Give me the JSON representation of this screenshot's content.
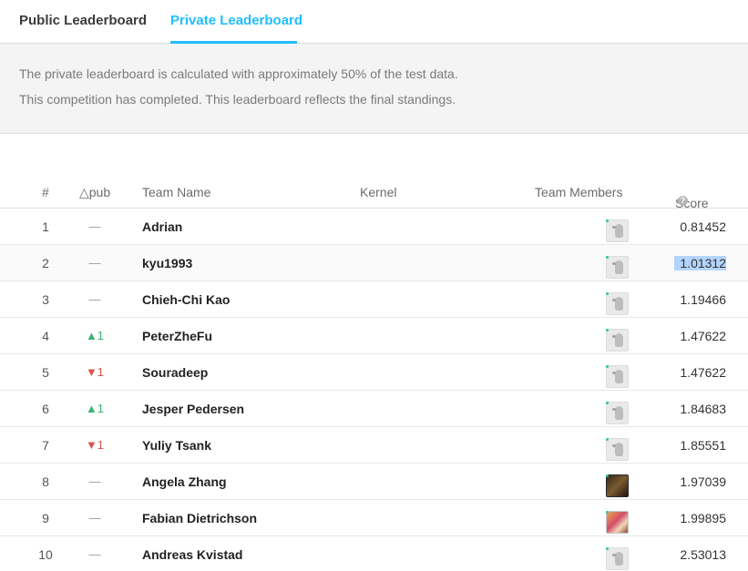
{
  "tabs": {
    "public": "Public Leaderboard",
    "private": "Private Leaderboard",
    "active": "private"
  },
  "info": {
    "line1": "The private leaderboard is calculated with approximately 50% of the test data.",
    "line2": "This competition has completed. This leaderboard reflects the final standings."
  },
  "columns": {
    "rank": "#",
    "pub": "△pub",
    "team": "Team Name",
    "kernel": "Kernel",
    "members": "Team Members",
    "score": "Score"
  },
  "icons": {
    "help": "question-circle-icon",
    "default_avatar": "bird-avatar-icon",
    "up": "triangle-up-icon",
    "down": "triangle-down-icon"
  },
  "colors": {
    "accent": "#20beff",
    "up": "#3cb371",
    "down": "#d9534f",
    "online": "#2ec4a8",
    "selection": "#b3d4fc"
  },
  "rows": [
    {
      "rank": "1",
      "pub": "—",
      "team": "Adrian",
      "kernel": "",
      "score": "0.81452",
      "avatar": "default"
    },
    {
      "rank": "2",
      "pub": "—",
      "team": "kyu1993",
      "kernel": "",
      "score": "1.01312",
      "avatar": "default"
    },
    {
      "rank": "3",
      "pub": "—",
      "team": "Chieh-Chi Kao",
      "kernel": "",
      "score": "1.19466",
      "avatar": "default"
    },
    {
      "rank": "4",
      "pub": "▲1",
      "team": "PeterZheFu",
      "kernel": "",
      "score": "1.47622",
      "avatar": "default"
    },
    {
      "rank": "5",
      "pub": "▼1",
      "team": "Souradeep",
      "kernel": "",
      "score": "1.47622",
      "avatar": "default"
    },
    {
      "rank": "6",
      "pub": "▲1",
      "team": "Jesper Pedersen",
      "kernel": "",
      "score": "1.84683",
      "avatar": "default"
    },
    {
      "rank": "7",
      "pub": "▼1",
      "team": "Yuliy Tsank",
      "kernel": "",
      "score": "1.85551",
      "avatar": "default"
    },
    {
      "rank": "8",
      "pub": "—",
      "team": "Angela Zhang",
      "kernel": "",
      "score": "1.97039",
      "avatar": "photo"
    },
    {
      "rank": "9",
      "pub": "—",
      "team": "Fabian Dietrichson",
      "kernel": "",
      "score": "1.99895",
      "avatar": "photo"
    },
    {
      "rank": "10",
      "pub": "—",
      "team": "Andreas Kvistad",
      "kernel": "",
      "score": "2.53013",
      "avatar": "default"
    }
  ]
}
